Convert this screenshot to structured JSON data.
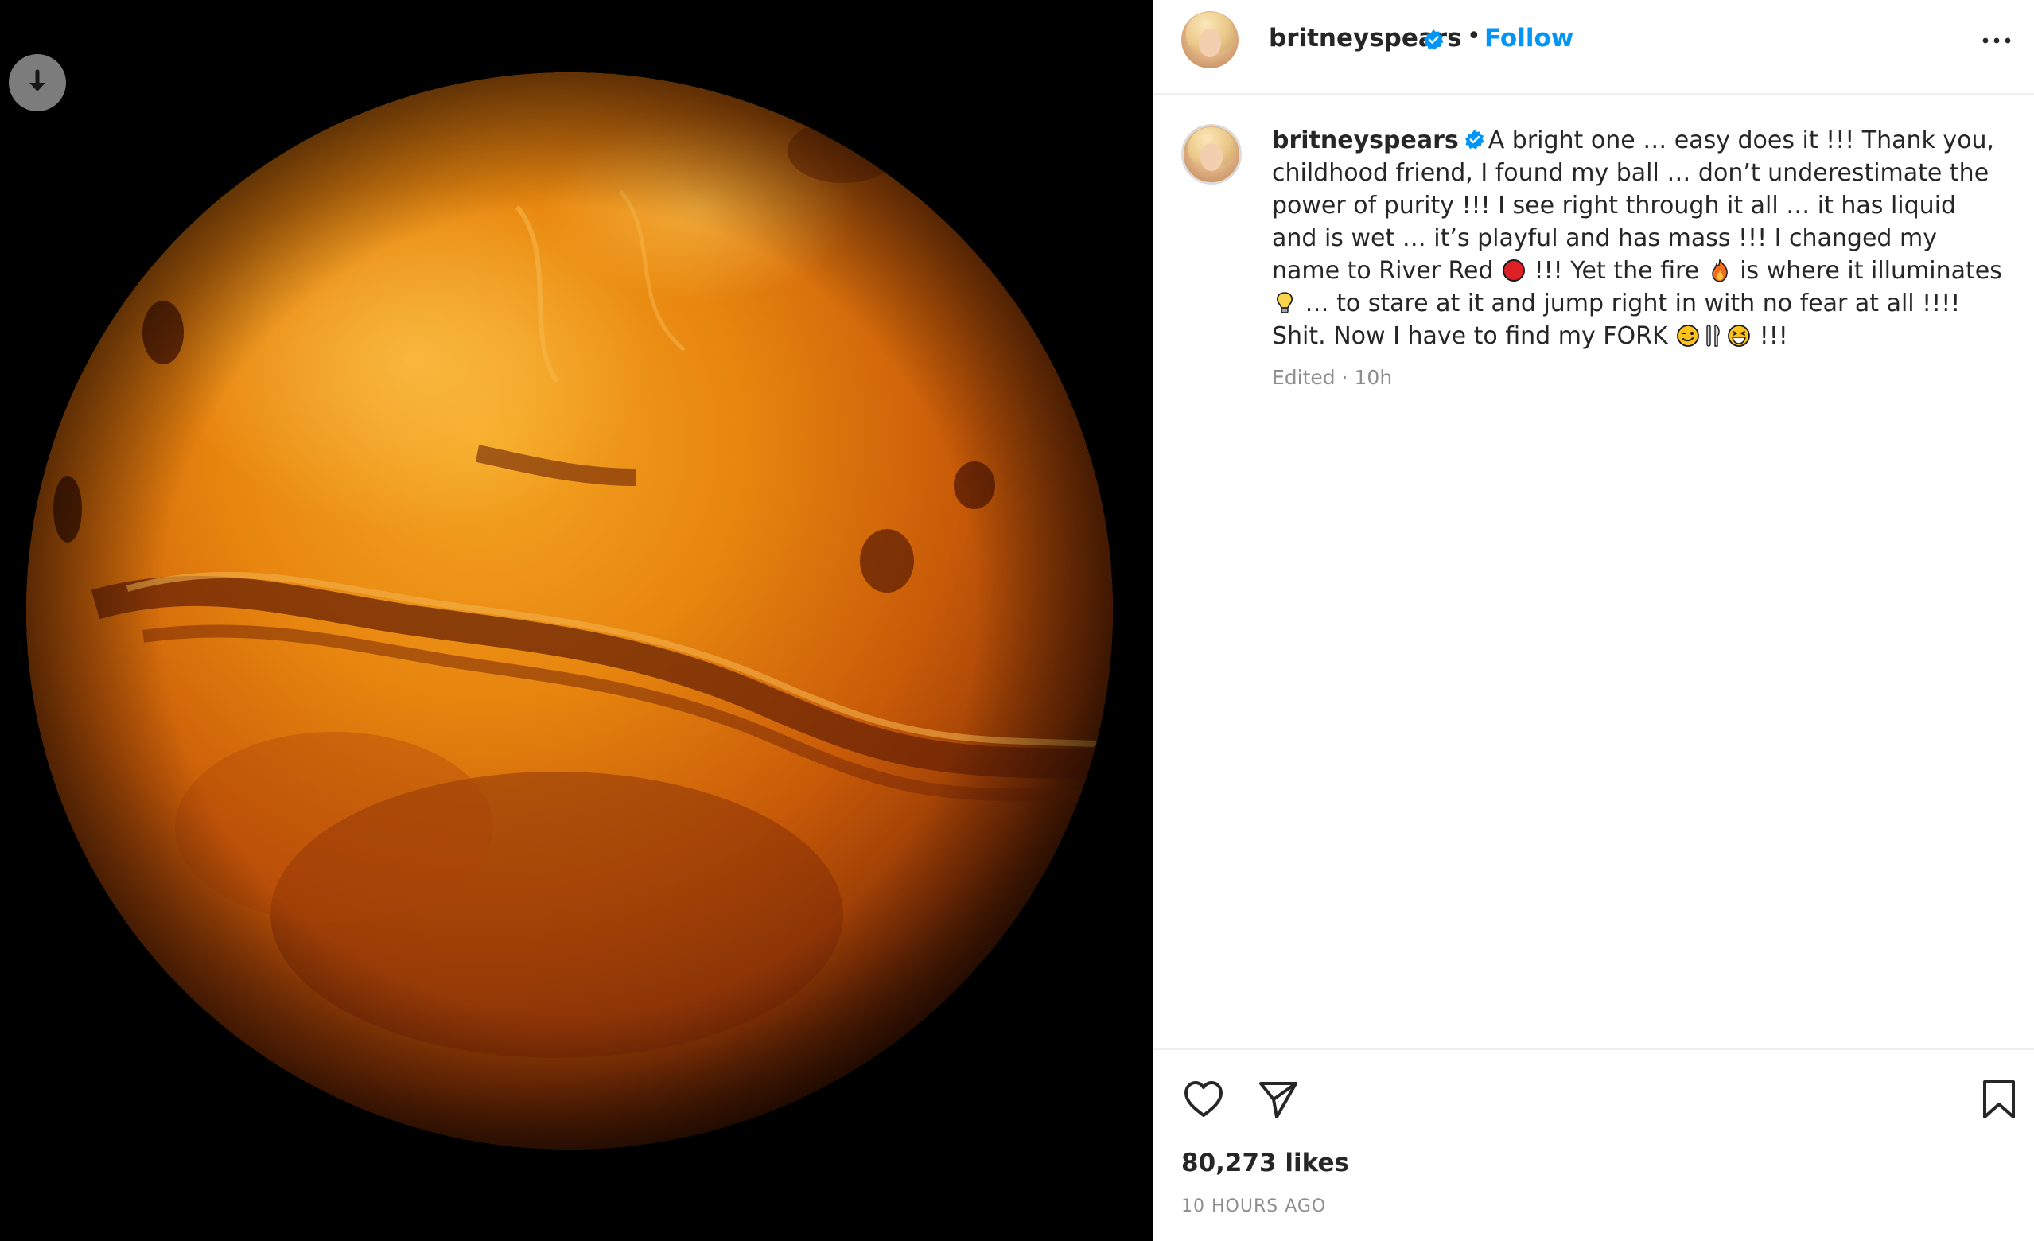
{
  "media": {
    "alt": "",
    "download_icon": "arrow-down-icon"
  },
  "header": {
    "username": "britneyspears",
    "verified_icon": "verified-badge-icon",
    "separator": "•",
    "follow_label": "Follow",
    "more_icon": "more-horizontal-icon"
  },
  "caption": {
    "username": "britneyspears",
    "text_1": "A bright one … easy does it !!! Thank you, childhood friend, I found my ball … don’t underestimate the power of purity !!! I see right through it all … it has liquid and is wet … it’s playful and has mass !!! I changed my name to River Red ",
    "text_2": " !!! Yet the fire ",
    "text_3": " is where it illuminates ",
    "text_4": " … to stare at it and jump right in with no fear at all !!!! Shit. Now I have to find my FORK ",
    "text_5": " !!!",
    "edited": "Edited · 10h"
  },
  "actions": {
    "like_icon": "heart-icon",
    "share_icon": "paper-plane-icon",
    "save_icon": "bookmark-icon"
  },
  "stats": {
    "likes": "80,273 likes",
    "timestamp": "10 HOURS AGO"
  },
  "colors": {
    "accent": "#0095f6",
    "text": "#262626",
    "muted": "#8e8e8e",
    "divider": "#efefef"
  }
}
